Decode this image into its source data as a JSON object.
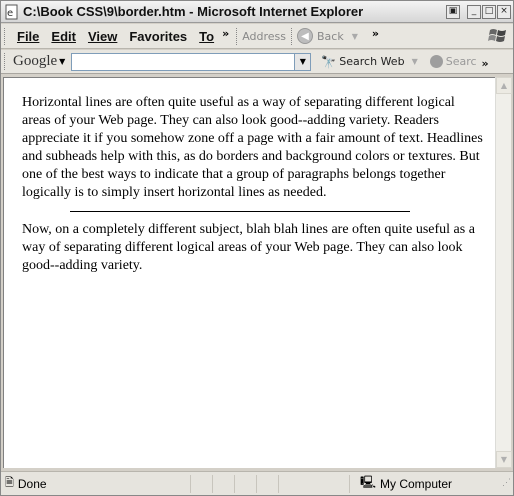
{
  "window": {
    "title": "C:\\Book CSS\\9\\border.htm - Microsoft Internet Explorer"
  },
  "menu": {
    "items": [
      {
        "label": "File"
      },
      {
        "label": "Edit"
      },
      {
        "label": "View"
      },
      {
        "label": "Favorites"
      },
      {
        "label": "To"
      }
    ],
    "overflow": "»",
    "address_label": "Address",
    "back_label": "Back",
    "overflow2": "»"
  },
  "google": {
    "logo": "Google",
    "search_value": "",
    "search_web_label": "Search Web",
    "search_results_label": "Searc",
    "overflow": "»"
  },
  "document": {
    "paragraph1": "Horizontal lines are often quite useful as a way of separating different logical areas of your Web page. They can also look good--adding variety. Readers appreciate it if you somehow zone off a page with a fair amount of text. Headlines and subheads help with this, as do borders and background colors or textures. But one of the best ways to indicate that a group of paragraphs belongs together logically is to simply insert horizontal lines as needed.",
    "paragraph2": "Now, on a completely different subject, blah blah lines are often quite useful as a way of separating different logical areas of your Web page. They can also look good--adding variety."
  },
  "status": {
    "text": "Done",
    "zone": "My Computer"
  },
  "icons": {
    "title": "ie-page-icon",
    "search_web": "binoculars-icon",
    "zone": "computer-icon"
  }
}
